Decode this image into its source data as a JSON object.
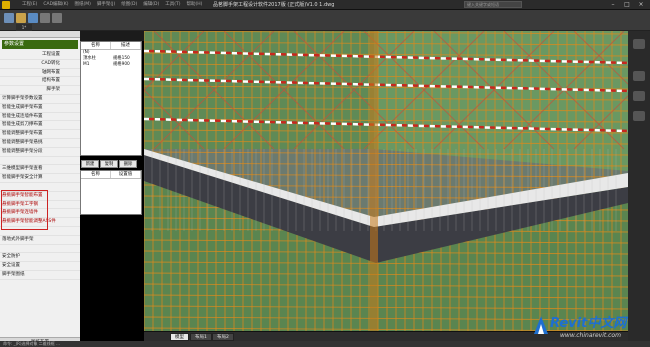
{
  "titlebar": {
    "title": "品茗脚手架工程设计软件2017版 (正式版)V1.0    1.dwg",
    "menus": [
      "工程(E)",
      "CAD编辑(K)",
      "图纸(M)",
      "脚手架(J)",
      "绘图(D)",
      "编辑(D)",
      "工具(T)",
      "帮助(H)"
    ],
    "search_placeholder": "键入关键字或短语",
    "window_controls": [
      "minimize-icon",
      "restore-icon",
      "close-icon"
    ]
  },
  "doc_tab": {
    "label": "1*"
  },
  "left_panel": {
    "dropdown_value": "参数设置",
    "items": [
      {
        "label": "工程设置",
        "align": "right"
      },
      {
        "label": "CAD转化",
        "align": "right"
      },
      {
        "label": "轴网布置",
        "align": "right"
      },
      {
        "label": "结构布置",
        "align": "right"
      },
      {
        "label": "脚手架",
        "align": "right"
      },
      {
        "label": "计算脚手架参数设置",
        "align": "left"
      },
      {
        "label": "智能生成脚手架布置",
        "align": "left"
      },
      {
        "label": "智能生成连墙件布置",
        "align": "left"
      },
      {
        "label": "智能生成剪刀撑布置",
        "align": "left"
      },
      {
        "label": "智能调整脚手架布置",
        "align": "left"
      },
      {
        "label": "智能调整脚手架悬挑",
        "align": "left"
      },
      {
        "label": "智能调整脚手架分段",
        "align": "left"
      },
      {
        "label": "",
        "align": "left"
      },
      {
        "label": "三维模型脚手架查看",
        "align": "left"
      },
      {
        "label": "智能脚手架安全计算",
        "align": "left"
      },
      {
        "label": "",
        "align": "left"
      },
      {
        "label": "悬挑脚手架智能布置",
        "align": "left",
        "highlight": true
      },
      {
        "label": "悬挑脚手架工字钢",
        "align": "left",
        "highlight": true
      },
      {
        "label": "悬挑脚手架连墙件",
        "align": "left",
        "highlight": true
      },
      {
        "label": "悬挑脚手架智能调整ASS件",
        "align": "left",
        "highlight": true
      },
      {
        "label": "",
        "align": "left"
      },
      {
        "label": "落地式外脚手架",
        "align": "left"
      },
      {
        "label": "",
        "align": "left"
      },
      {
        "label": "安全防护",
        "align": "left"
      },
      {
        "label": "安全设置",
        "align": "left"
      },
      {
        "label": "脚手架图纸",
        "align": "left"
      }
    ],
    "footer": "图纸布置"
  },
  "property_panel": {
    "columns": [
      "名称",
      "描述"
    ],
    "rows": [
      {
        "name": "(N)",
        "desc": ""
      },
      {
        "name": "顶水柱",
        "desc": "规格150"
      },
      {
        "name": "M1",
        "desc": "规格900"
      }
    ],
    "buttons": [
      "新建",
      "复制",
      "删除"
    ],
    "sub_columns": [
      "名称",
      "设置值"
    ]
  },
  "bottom_tabs": [
    {
      "label": "模型",
      "active": true
    },
    {
      "label": "布局1",
      "active": false
    },
    {
      "label": "布局2",
      "active": false
    }
  ],
  "status_bar": {
    "text": "命令: _(R)选择对象 二维线框 ..."
  },
  "watermark": {
    "brand": "Revit中文网",
    "url": "www.chinarevit.com"
  },
  "colors": {
    "scaffold_orange": "#d98a1e",
    "mesh_green": "#6f9b5a",
    "slab_white": "#e8e8e8",
    "redbox": "#cc2222"
  }
}
